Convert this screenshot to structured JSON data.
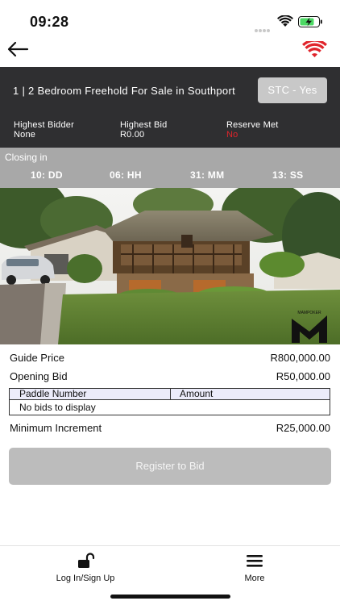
{
  "status": {
    "time": "09:28"
  },
  "listing": {
    "title": "1 | 2 Bedroom Freehold For Sale in Southport",
    "stc_badge": "STC - Yes",
    "stats": [
      {
        "label": "Highest Bidder",
        "value": "None"
      },
      {
        "label": "Highest Bid",
        "value": "R0.00"
      },
      {
        "label": "Reserve Met",
        "value": "No"
      }
    ]
  },
  "countdown": {
    "label": "Closing in",
    "items": [
      "10: DD",
      "06: HH",
      "31: MM",
      "13: SS"
    ]
  },
  "details": {
    "guide_price_label": "Guide Price",
    "guide_price_value": "R800,000.00",
    "opening_bid_label": "Opening Bid",
    "opening_bid_value": "R50,000.00",
    "min_increment_label": "Minimum Increment",
    "min_increment_value": "R25,000.00"
  },
  "bids_table": {
    "columns": [
      "Paddle Number",
      "Amount"
    ],
    "empty_text": "No bids to display"
  },
  "register_button": "Register to Bid",
  "tabs": [
    {
      "label": "Log In/Sign Up",
      "icon": "unlock-icon"
    },
    {
      "label": "More",
      "icon": "hamburger-menu-icon"
    }
  ],
  "colors": {
    "dark_panel": "#2f2f31",
    "countdown_bg": "#a8a8a8",
    "reserve_no": "#e0242b",
    "wifi_brand": "#e0242b",
    "button_disabled": "#bcbcbc"
  }
}
